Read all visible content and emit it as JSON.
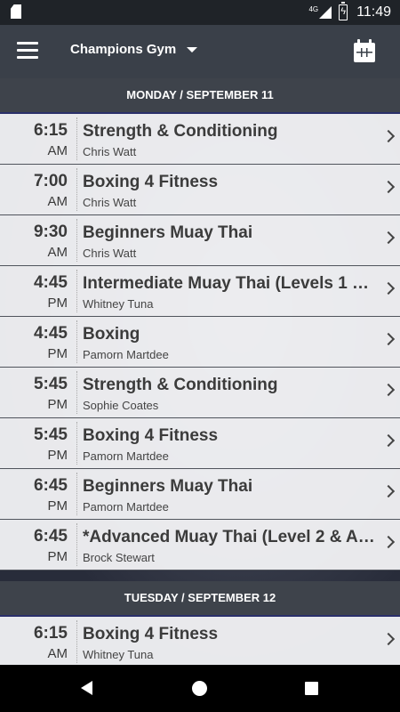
{
  "status_bar": {
    "network": "4G",
    "time": "11:49",
    "icons": [
      "sd-card-icon",
      "signal-icon",
      "battery-charging-icon"
    ]
  },
  "app_bar": {
    "gym_name": "Champions Gym",
    "icons": [
      "menu-icon",
      "dropdown-caret-icon",
      "calendar-icon"
    ]
  },
  "days": [
    {
      "header": "MONDAY / SEPTEMBER 11",
      "classes": [
        {
          "time": "6:15",
          "ampm": "AM",
          "name": "Strength & Conditioning",
          "instructor": "Chris Watt"
        },
        {
          "time": "7:00",
          "ampm": "AM",
          "name": "Boxing 4 Fitness",
          "instructor": "Chris Watt"
        },
        {
          "time": "9:30",
          "ampm": "AM",
          "name": "Beginners Muay Thai",
          "instructor": "Chris Watt"
        },
        {
          "time": "4:45",
          "ampm": "PM",
          "name": "Intermediate Muay Thai (Levels 1 &…",
          "instructor": "Whitney Tuna"
        },
        {
          "time": "4:45",
          "ampm": "PM",
          "name": "Boxing",
          "instructor": "Pamorn Martdee"
        },
        {
          "time": "5:45",
          "ampm": "PM",
          "name": "Strength & Conditioning",
          "instructor": "Sophie Coates"
        },
        {
          "time": "5:45",
          "ampm": "PM",
          "name": "Boxing 4 Fitness",
          "instructor": "Pamorn Martdee"
        },
        {
          "time": "6:45",
          "ampm": "PM",
          "name": "Beginners Muay Thai",
          "instructor": "Pamorn Martdee"
        },
        {
          "time": "6:45",
          "ampm": "PM",
          "name": "*Advanced Muay Thai (Level 2 & A…",
          "instructor": "Brock Stewart"
        }
      ]
    },
    {
      "header": "TUESDAY / SEPTEMBER 12",
      "classes": [
        {
          "time": "6:15",
          "ampm": "AM",
          "name": "Boxing 4 Fitness",
          "instructor": "Whitney Tuna"
        }
      ]
    }
  ],
  "nav_bar": {
    "icons": [
      "back-icon",
      "home-icon",
      "recents-icon"
    ]
  }
}
